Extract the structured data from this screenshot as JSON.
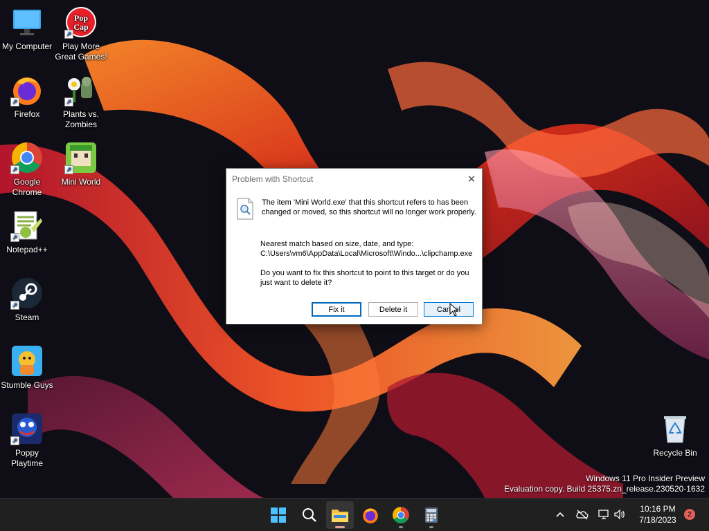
{
  "desktop": {
    "icons": [
      {
        "label": "My Computer",
        "icon": "monitor-icon"
      },
      {
        "label": "Play More\nGreat Games!",
        "icon": "popcap-icon"
      },
      {
        "label": "Firefox",
        "icon": "firefox-icon"
      },
      {
        "label": "Plants vs.\nZombies",
        "icon": "plants-vs-zombies-icon"
      },
      {
        "label": "Google\nChrome",
        "icon": "chrome-icon"
      },
      {
        "label": "Mini World",
        "icon": "mini-world-icon"
      },
      {
        "label": "Notepad++",
        "icon": "notepad-plus-plus-icon"
      },
      {
        "label": "Steam",
        "icon": "steam-icon"
      },
      {
        "label": "Stumble Guys",
        "icon": "stumble-guys-icon"
      },
      {
        "label": "Poppy\nPlaytime",
        "icon": "poppy-playtime-icon"
      },
      {
        "label": "Recycle Bin",
        "icon": "recycle-bin-icon"
      }
    ],
    "popcap_logo_text": [
      "Pop",
      "Cap"
    ]
  },
  "dialog": {
    "title": "Problem with Shortcut",
    "message": "The item 'Mini World.exe' that this shortcut refers to has been changed or moved, so this shortcut will no longer work properly.",
    "match_label": "Nearest match based on size, date, and type:",
    "match_path": "C:\\Users\\vm6\\AppData\\Local\\Microsoft\\Windo...\\clipchamp.exe",
    "question": "Do you want to fix this shortcut to point to this target or do you just want to delete it?",
    "buttons": {
      "fix": "Fix it",
      "delete": "Delete it",
      "cancel": "Cancel"
    }
  },
  "watermark": {
    "line1": "Windows 11 Pro Insider Preview",
    "line2": "Evaluation copy. Build 25375.zn_release.230520-1632"
  },
  "taskbar": {
    "apps": [
      "start-icon",
      "search-icon",
      "file-explorer-icon",
      "firefox-icon",
      "chrome-icon",
      "calculator-icon"
    ],
    "clock_time": "10:16 PM",
    "clock_date": "7/18/2023",
    "notification_count": "2"
  },
  "colors": {
    "accent": "#0067c0",
    "taskbar_bg": "#202020",
    "notification_badge": "#e0605a"
  }
}
